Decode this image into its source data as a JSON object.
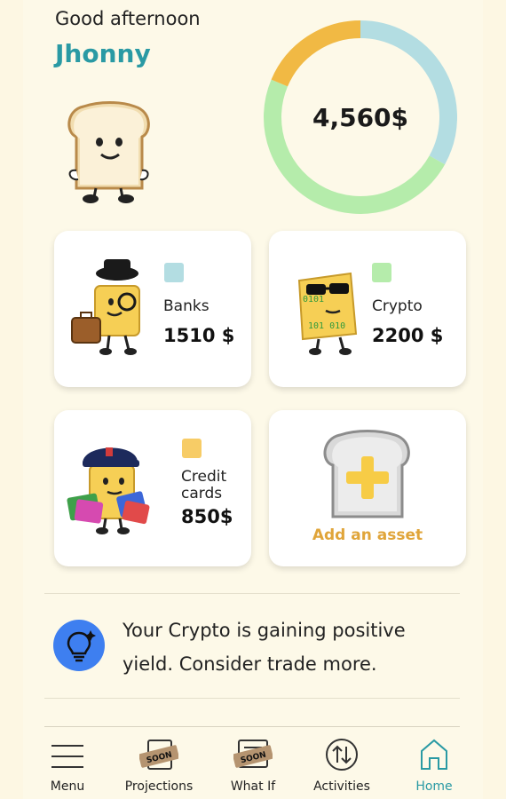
{
  "header": {
    "greeting": "Good afternoon",
    "user_name": "Jhonny"
  },
  "balance": {
    "total": "4,560$",
    "segments": [
      {
        "name": "Banks",
        "value": 1510,
        "color": "#b3dde2"
      },
      {
        "name": "Crypto",
        "value": 2200,
        "color": "#b5ecab"
      },
      {
        "name": "Credit cards",
        "value": 850,
        "color": "#f1b944"
      }
    ]
  },
  "assets": [
    {
      "label": "Banks",
      "amount": "1510 $",
      "color": "#b3dde2"
    },
    {
      "label": "Crypto",
      "amount": "2200 $",
      "color": "#b5ecab"
    },
    {
      "label_line1": "Credit",
      "label_line2": "cards",
      "amount": "850$",
      "color": "#f7cc66"
    }
  ],
  "add_asset": {
    "label": "Add an asset"
  },
  "insight": {
    "line1": "Your Crypto is gaining positive",
    "line2": "yield. Consider trade more."
  },
  "nav": {
    "items": [
      {
        "label": "Menu",
        "icon": "hamburger-icon"
      },
      {
        "label": "Projections",
        "icon": "projections-icon",
        "badge": "SOON"
      },
      {
        "label": "What If",
        "icon": "what-if-icon",
        "badge": "SOON"
      },
      {
        "label": "Activities",
        "icon": "activities-icon"
      },
      {
        "label": "Home",
        "icon": "home-icon",
        "active": true
      }
    ]
  },
  "colors": {
    "accent": "#2a9aa4",
    "background": "#fdf9e8",
    "add_asset": "#e0a53a",
    "insight_icon": "#3e7ff0"
  }
}
